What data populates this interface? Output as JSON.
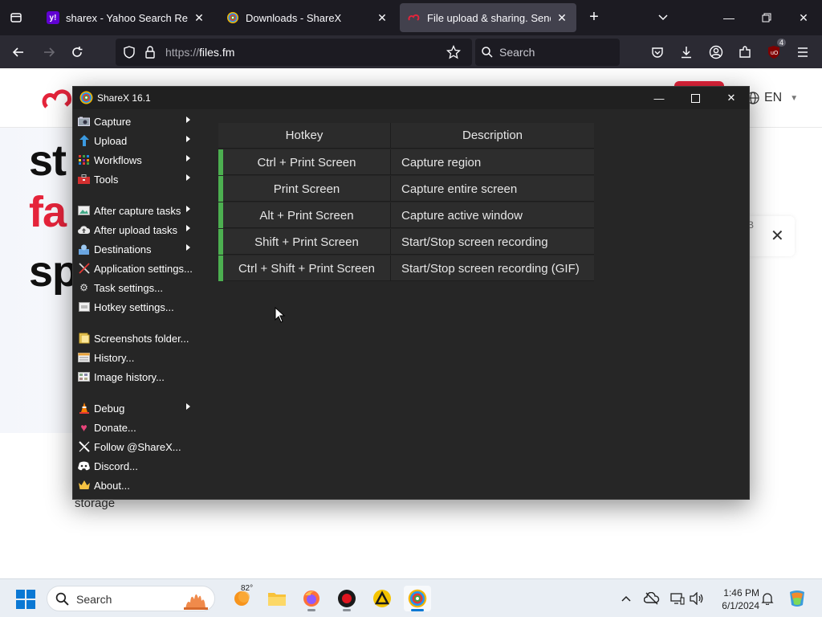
{
  "browser": {
    "tabs": [
      {
        "title": "sharex - Yahoo Search Results",
        "favicon": "yahoo-icon",
        "active": false
      },
      {
        "title": "Downloads - ShareX",
        "favicon": "sharex-icon",
        "active": false
      },
      {
        "title": "File upload & sharing. Send lar",
        "favicon": "filesfm-icon",
        "active": true
      }
    ],
    "url_prefix": "https://",
    "url_host": "files.fm",
    "search_placeholder": "Search",
    "extension_badge": "4"
  },
  "webpage": {
    "lang_label": "EN",
    "hero_lines": [
      "st",
      "fa",
      "sp"
    ],
    "storage_text": "storage",
    "cookie_partial": "B"
  },
  "sharex": {
    "title": "ShareX 16.1",
    "menu": [
      {
        "label": "Capture",
        "icon": "camera-icon",
        "submenu": true
      },
      {
        "label": "Upload",
        "icon": "upload-arrow-icon",
        "submenu": true
      },
      {
        "label": "Workflows",
        "icon": "workflows-grid-icon",
        "submenu": true
      },
      {
        "label": "Tools",
        "icon": "toolbox-icon",
        "submenu": true
      },
      {
        "label": "After capture tasks",
        "icon": "image-tasks-icon",
        "submenu": true
      },
      {
        "label": "After upload tasks",
        "icon": "cloud-upload-icon",
        "submenu": true
      },
      {
        "label": "Destinations",
        "icon": "destinations-icon",
        "submenu": true
      },
      {
        "label": "Application settings...",
        "icon": "wrench-screwdriver-icon",
        "submenu": false
      },
      {
        "label": "Task settings...",
        "icon": "gear-icon",
        "submenu": false
      },
      {
        "label": "Hotkey settings...",
        "icon": "keyboard-icon",
        "submenu": false
      },
      {
        "label": "Screenshots folder...",
        "icon": "folder-icon",
        "submenu": false
      },
      {
        "label": "History...",
        "icon": "history-icon",
        "submenu": false
      },
      {
        "label": "Image history...",
        "icon": "image-history-icon",
        "submenu": false
      },
      {
        "label": "Debug",
        "icon": "traffic-cone-icon",
        "submenu": true
      },
      {
        "label": "Donate...",
        "icon": "heart-icon",
        "submenu": false
      },
      {
        "label": "Follow @ShareX...",
        "icon": "x-logo-icon",
        "submenu": false
      },
      {
        "label": "Discord...",
        "icon": "discord-icon",
        "submenu": false
      },
      {
        "label": "About...",
        "icon": "crown-icon",
        "submenu": false
      }
    ],
    "hotkey_table": {
      "headers": [
        "Hotkey",
        "Description"
      ],
      "rows": [
        {
          "hotkey": "Ctrl + Print Screen",
          "description": "Capture region"
        },
        {
          "hotkey": "Print Screen",
          "description": "Capture entire screen"
        },
        {
          "hotkey": "Alt + Print Screen",
          "description": "Capture active window"
        },
        {
          "hotkey": "Shift + Print Screen",
          "description": "Start/Stop screen recording"
        },
        {
          "hotkey": "Ctrl + Shift + Print Screen",
          "description": "Start/Stop screen recording (GIF)"
        }
      ],
      "status_color": "#4caf50"
    }
  },
  "taskbar": {
    "search_placeholder": "Search",
    "weather_temp": "82°",
    "time": "1:46 PM",
    "date": "6/1/2024",
    "apps": [
      "weather-icon",
      "file-explorer-icon",
      "firefox-icon",
      "obs-record-icon",
      "app-triangle-icon",
      "sharex-taskbar-icon"
    ]
  }
}
